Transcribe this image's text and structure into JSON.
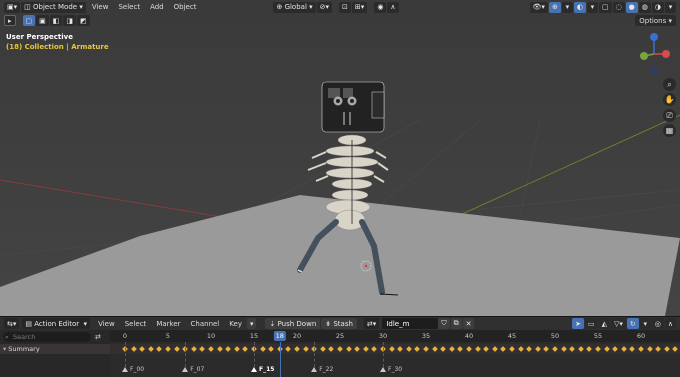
{
  "viewport": {
    "mode": "Object Mode",
    "menus": [
      "View",
      "Select",
      "Add",
      "Object"
    ],
    "transform_orientation": "Global",
    "options_label": "Options",
    "perspective_label": "User Perspective",
    "collection_label": "(18) Collection",
    "object_label": "Armature"
  },
  "action_editor": {
    "mode": "Action Editor",
    "menus": [
      "View",
      "Select",
      "Marker",
      "Channel",
      "Key"
    ],
    "push_down_label": "Push Down",
    "stash_label": "Stash",
    "action_name": "Idle_m",
    "search_placeholder": "Search",
    "summary_label": "Summary"
  },
  "timeline": {
    "ticks": [
      "0",
      "5",
      "10",
      "15",
      "18",
      "20",
      "25",
      "30",
      "35",
      "40",
      "45",
      "50",
      "55",
      "60"
    ],
    "current_frame": "18",
    "markers": [
      {
        "label": "F_00",
        "frame": 0,
        "selected": false
      },
      {
        "label": "F_07",
        "frame": 7,
        "selected": false
      },
      {
        "label": "F_15",
        "frame": 15,
        "selected": true
      },
      {
        "label": "F_22",
        "frame": 22,
        "selected": false
      },
      {
        "label": "F_30",
        "frame": 30,
        "selected": false
      }
    ],
    "accent_color": "#4772b3",
    "key_color": "#e8b23a"
  }
}
